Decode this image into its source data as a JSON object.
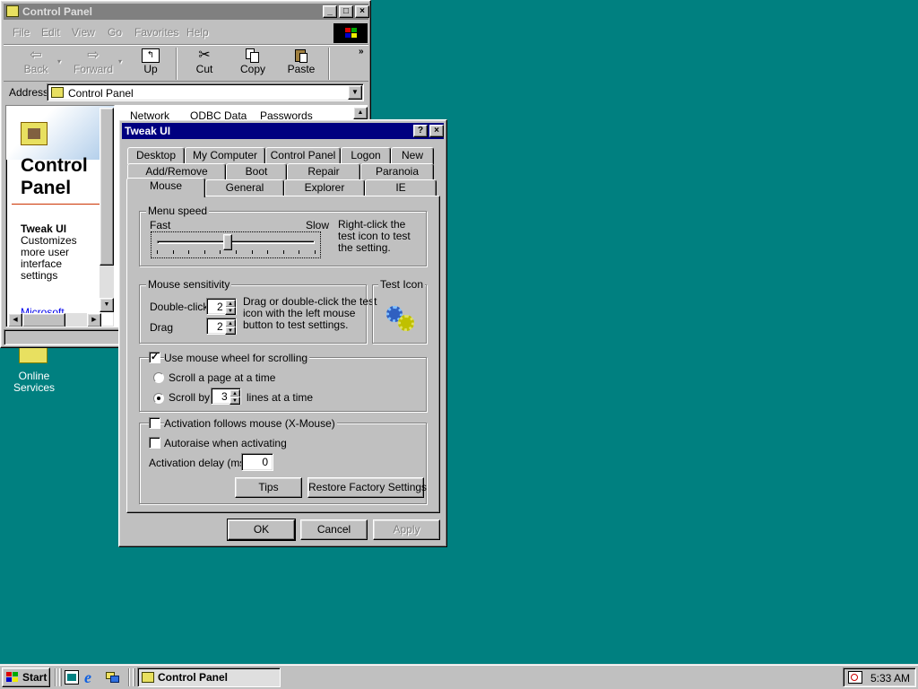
{
  "desktop": {
    "online_services": "Online\nServices"
  },
  "control_panel": {
    "title": "Control Panel",
    "menu": [
      "File",
      "Edit",
      "View",
      "Go",
      "Favorites",
      "Help"
    ],
    "toolbar": {
      "back": "Back",
      "forward": "Forward",
      "up": "Up",
      "cut": "Cut",
      "copy": "Copy",
      "paste": "Paste"
    },
    "address_label": "Address",
    "address_value": "Control Panel",
    "heading": "Control\nPanel",
    "selected_item": "Tweak UI",
    "description": "Customizes\nmore user\ninterface\nsettings",
    "link": "Microsoft",
    "list_items": [
      "Network",
      "ODBC Data",
      "Passwords"
    ]
  },
  "tweakui": {
    "title": "Tweak UI",
    "tabs_row1": [
      "Desktop",
      "My Computer",
      "Control Panel",
      "Logon",
      "New"
    ],
    "tabs_row2": [
      "Add/Remove",
      "Boot",
      "Repair",
      "Paranoia"
    ],
    "tabs_row3": [
      "Mouse",
      "General",
      "Explorer",
      "IE"
    ],
    "menu_speed": {
      "legend": "Menu speed",
      "fast": "Fast",
      "slow": "Slow",
      "hint": "Right-click the\ntest icon to test\nthe setting.",
      "value": 0.45
    },
    "sensitivity": {
      "legend": "Mouse sensitivity",
      "double_click_label": "Double-click",
      "double_click_value": "2",
      "drag_label": "Drag",
      "drag_value": "2",
      "hint": "Drag or double-click the test\nicon with the left mouse\nbutton to test settings."
    },
    "test_icon": {
      "legend": "Test Icon"
    },
    "wheel": {
      "use_label": "Use mouse wheel for scrolling",
      "use_checked": true,
      "page_label": "Scroll a page at a time",
      "by_label": "Scroll by",
      "by_value": "3",
      "lines_label": "lines at a time"
    },
    "xmouse": {
      "follows_label": "Activation follows mouse (X-Mouse)",
      "autoraise_label": "Autoraise when activating",
      "delay_label": "Activation delay (ms):",
      "delay_value": "0"
    },
    "buttons": {
      "tips": "Tips",
      "restore": "Restore Factory Settings",
      "ok": "OK",
      "cancel": "Cancel",
      "apply": "Apply"
    }
  },
  "taskbar": {
    "start": "Start",
    "task": "Control Panel",
    "time": "5:33 AM"
  },
  "colors": {
    "desktop": "#008080",
    "titlebar_active": "#000080",
    "titlebar_inactive": "#808080",
    "face": "#c0c0c0"
  }
}
